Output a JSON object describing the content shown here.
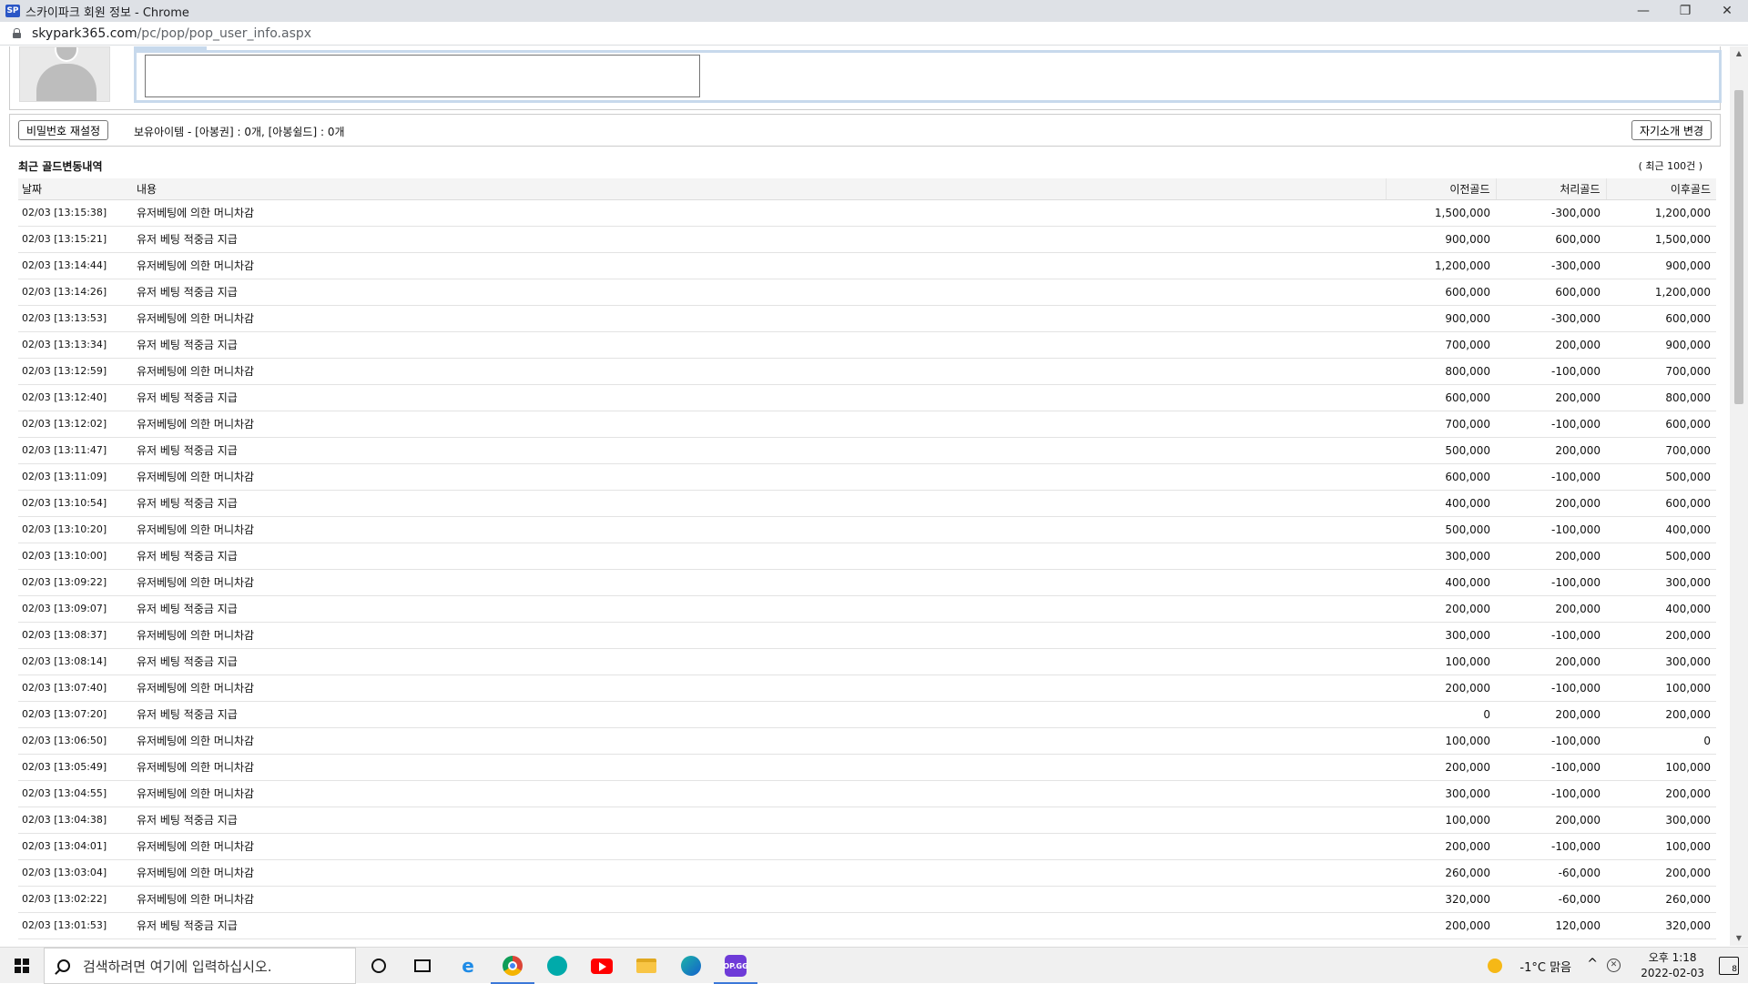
{
  "window": {
    "favicon_text": "SP",
    "title": "스카이파크 회원 정보 - Chrome",
    "url_host": "skypark365.com",
    "url_path": "/pc/pop/pop_user_info.aspx"
  },
  "profile": {
    "intro_value": ""
  },
  "actions": {
    "password_reset_label": "비밀번호 재설정",
    "items_text": "보유아이템 - [아봉권] : 0개, [아봉쉴드] : 0개",
    "change_intro_label": "자기소개 변경"
  },
  "gold_log": {
    "title": "최근 골드변동내역",
    "count_text": "( 최근 100건 )",
    "headers": [
      "날짜",
      "내용",
      "이전골드",
      "처리골드",
      "이후골드"
    ],
    "rows": [
      {
        "date": "02/03 [13:15:38]",
        "desc": "유저베팅에 의한 머니차감",
        "before": "1,500,000",
        "change": "-300,000",
        "after": "1,200,000"
      },
      {
        "date": "02/03 [13:15:21]",
        "desc": "유저 베팅 적중금 지급",
        "before": "900,000",
        "change": "600,000",
        "after": "1,500,000"
      },
      {
        "date": "02/03 [13:14:44]",
        "desc": "유저베팅에 의한 머니차감",
        "before": "1,200,000",
        "change": "-300,000",
        "after": "900,000"
      },
      {
        "date": "02/03 [13:14:26]",
        "desc": "유저 베팅 적중금 지급",
        "before": "600,000",
        "change": "600,000",
        "after": "1,200,000"
      },
      {
        "date": "02/03 [13:13:53]",
        "desc": "유저베팅에 의한 머니차감",
        "before": "900,000",
        "change": "-300,000",
        "after": "600,000"
      },
      {
        "date": "02/03 [13:13:34]",
        "desc": "유저 베팅 적중금 지급",
        "before": "700,000",
        "change": "200,000",
        "after": "900,000"
      },
      {
        "date": "02/03 [13:12:59]",
        "desc": "유저베팅에 의한 머니차감",
        "before": "800,000",
        "change": "-100,000",
        "after": "700,000"
      },
      {
        "date": "02/03 [13:12:40]",
        "desc": "유저 베팅 적중금 지급",
        "before": "600,000",
        "change": "200,000",
        "after": "800,000"
      },
      {
        "date": "02/03 [13:12:02]",
        "desc": "유저베팅에 의한 머니차감",
        "before": "700,000",
        "change": "-100,000",
        "after": "600,000"
      },
      {
        "date": "02/03 [13:11:47]",
        "desc": "유저 베팅 적중금 지급",
        "before": "500,000",
        "change": "200,000",
        "after": "700,000"
      },
      {
        "date": "02/03 [13:11:09]",
        "desc": "유저베팅에 의한 머니차감",
        "before": "600,000",
        "change": "-100,000",
        "after": "500,000"
      },
      {
        "date": "02/03 [13:10:54]",
        "desc": "유저 베팅 적중금 지급",
        "before": "400,000",
        "change": "200,000",
        "after": "600,000"
      },
      {
        "date": "02/03 [13:10:20]",
        "desc": "유저베팅에 의한 머니차감",
        "before": "500,000",
        "change": "-100,000",
        "after": "400,000"
      },
      {
        "date": "02/03 [13:10:00]",
        "desc": "유저 베팅 적중금 지급",
        "before": "300,000",
        "change": "200,000",
        "after": "500,000"
      },
      {
        "date": "02/03 [13:09:22]",
        "desc": "유저베팅에 의한 머니차감",
        "before": "400,000",
        "change": "-100,000",
        "after": "300,000"
      },
      {
        "date": "02/03 [13:09:07]",
        "desc": "유저 베팅 적중금 지급",
        "before": "200,000",
        "change": "200,000",
        "after": "400,000"
      },
      {
        "date": "02/03 [13:08:37]",
        "desc": "유저베팅에 의한 머니차감",
        "before": "300,000",
        "change": "-100,000",
        "after": "200,000"
      },
      {
        "date": "02/03 [13:08:14]",
        "desc": "유저 베팅 적중금 지급",
        "before": "100,000",
        "change": "200,000",
        "after": "300,000"
      },
      {
        "date": "02/03 [13:07:40]",
        "desc": "유저베팅에 의한 머니차감",
        "before": "200,000",
        "change": "-100,000",
        "after": "100,000"
      },
      {
        "date": "02/03 [13:07:20]",
        "desc": "유저 베팅 적중금 지급",
        "before": "0",
        "change": "200,000",
        "after": "200,000"
      },
      {
        "date": "02/03 [13:06:50]",
        "desc": "유저베팅에 의한 머니차감",
        "before": "100,000",
        "change": "-100,000",
        "after": "0"
      },
      {
        "date": "02/03 [13:05:49]",
        "desc": "유저베팅에 의한 머니차감",
        "before": "200,000",
        "change": "-100,000",
        "after": "100,000"
      },
      {
        "date": "02/03 [13:04:55]",
        "desc": "유저베팅에 의한 머니차감",
        "before": "300,000",
        "change": "-100,000",
        "after": "200,000"
      },
      {
        "date": "02/03 [13:04:38]",
        "desc": "유저 베팅 적중금 지급",
        "before": "100,000",
        "change": "200,000",
        "after": "300,000"
      },
      {
        "date": "02/03 [13:04:01]",
        "desc": "유저베팅에 의한 머니차감",
        "before": "200,000",
        "change": "-100,000",
        "after": "100,000"
      },
      {
        "date": "02/03 [13:03:04]",
        "desc": "유저베팅에 의한 머니차감",
        "before": "260,000",
        "change": "-60,000",
        "after": "200,000"
      },
      {
        "date": "02/03 [13:02:22]",
        "desc": "유저베팅에 의한 머니차감",
        "before": "320,000",
        "change": "-60,000",
        "after": "260,000"
      },
      {
        "date": "02/03 [13:01:53]",
        "desc": "유저 베팅 적중금 지급",
        "before": "200,000",
        "change": "120,000",
        "after": "320,000"
      }
    ]
  },
  "taskbar": {
    "search_placeholder": "검색하려면 여기에 입력하십시오.",
    "opgg_text": "OP.GG",
    "weather": "-1°C  맑음",
    "time": "오후 1:18",
    "date": "2022-02-03",
    "notification_count": "8"
  }
}
